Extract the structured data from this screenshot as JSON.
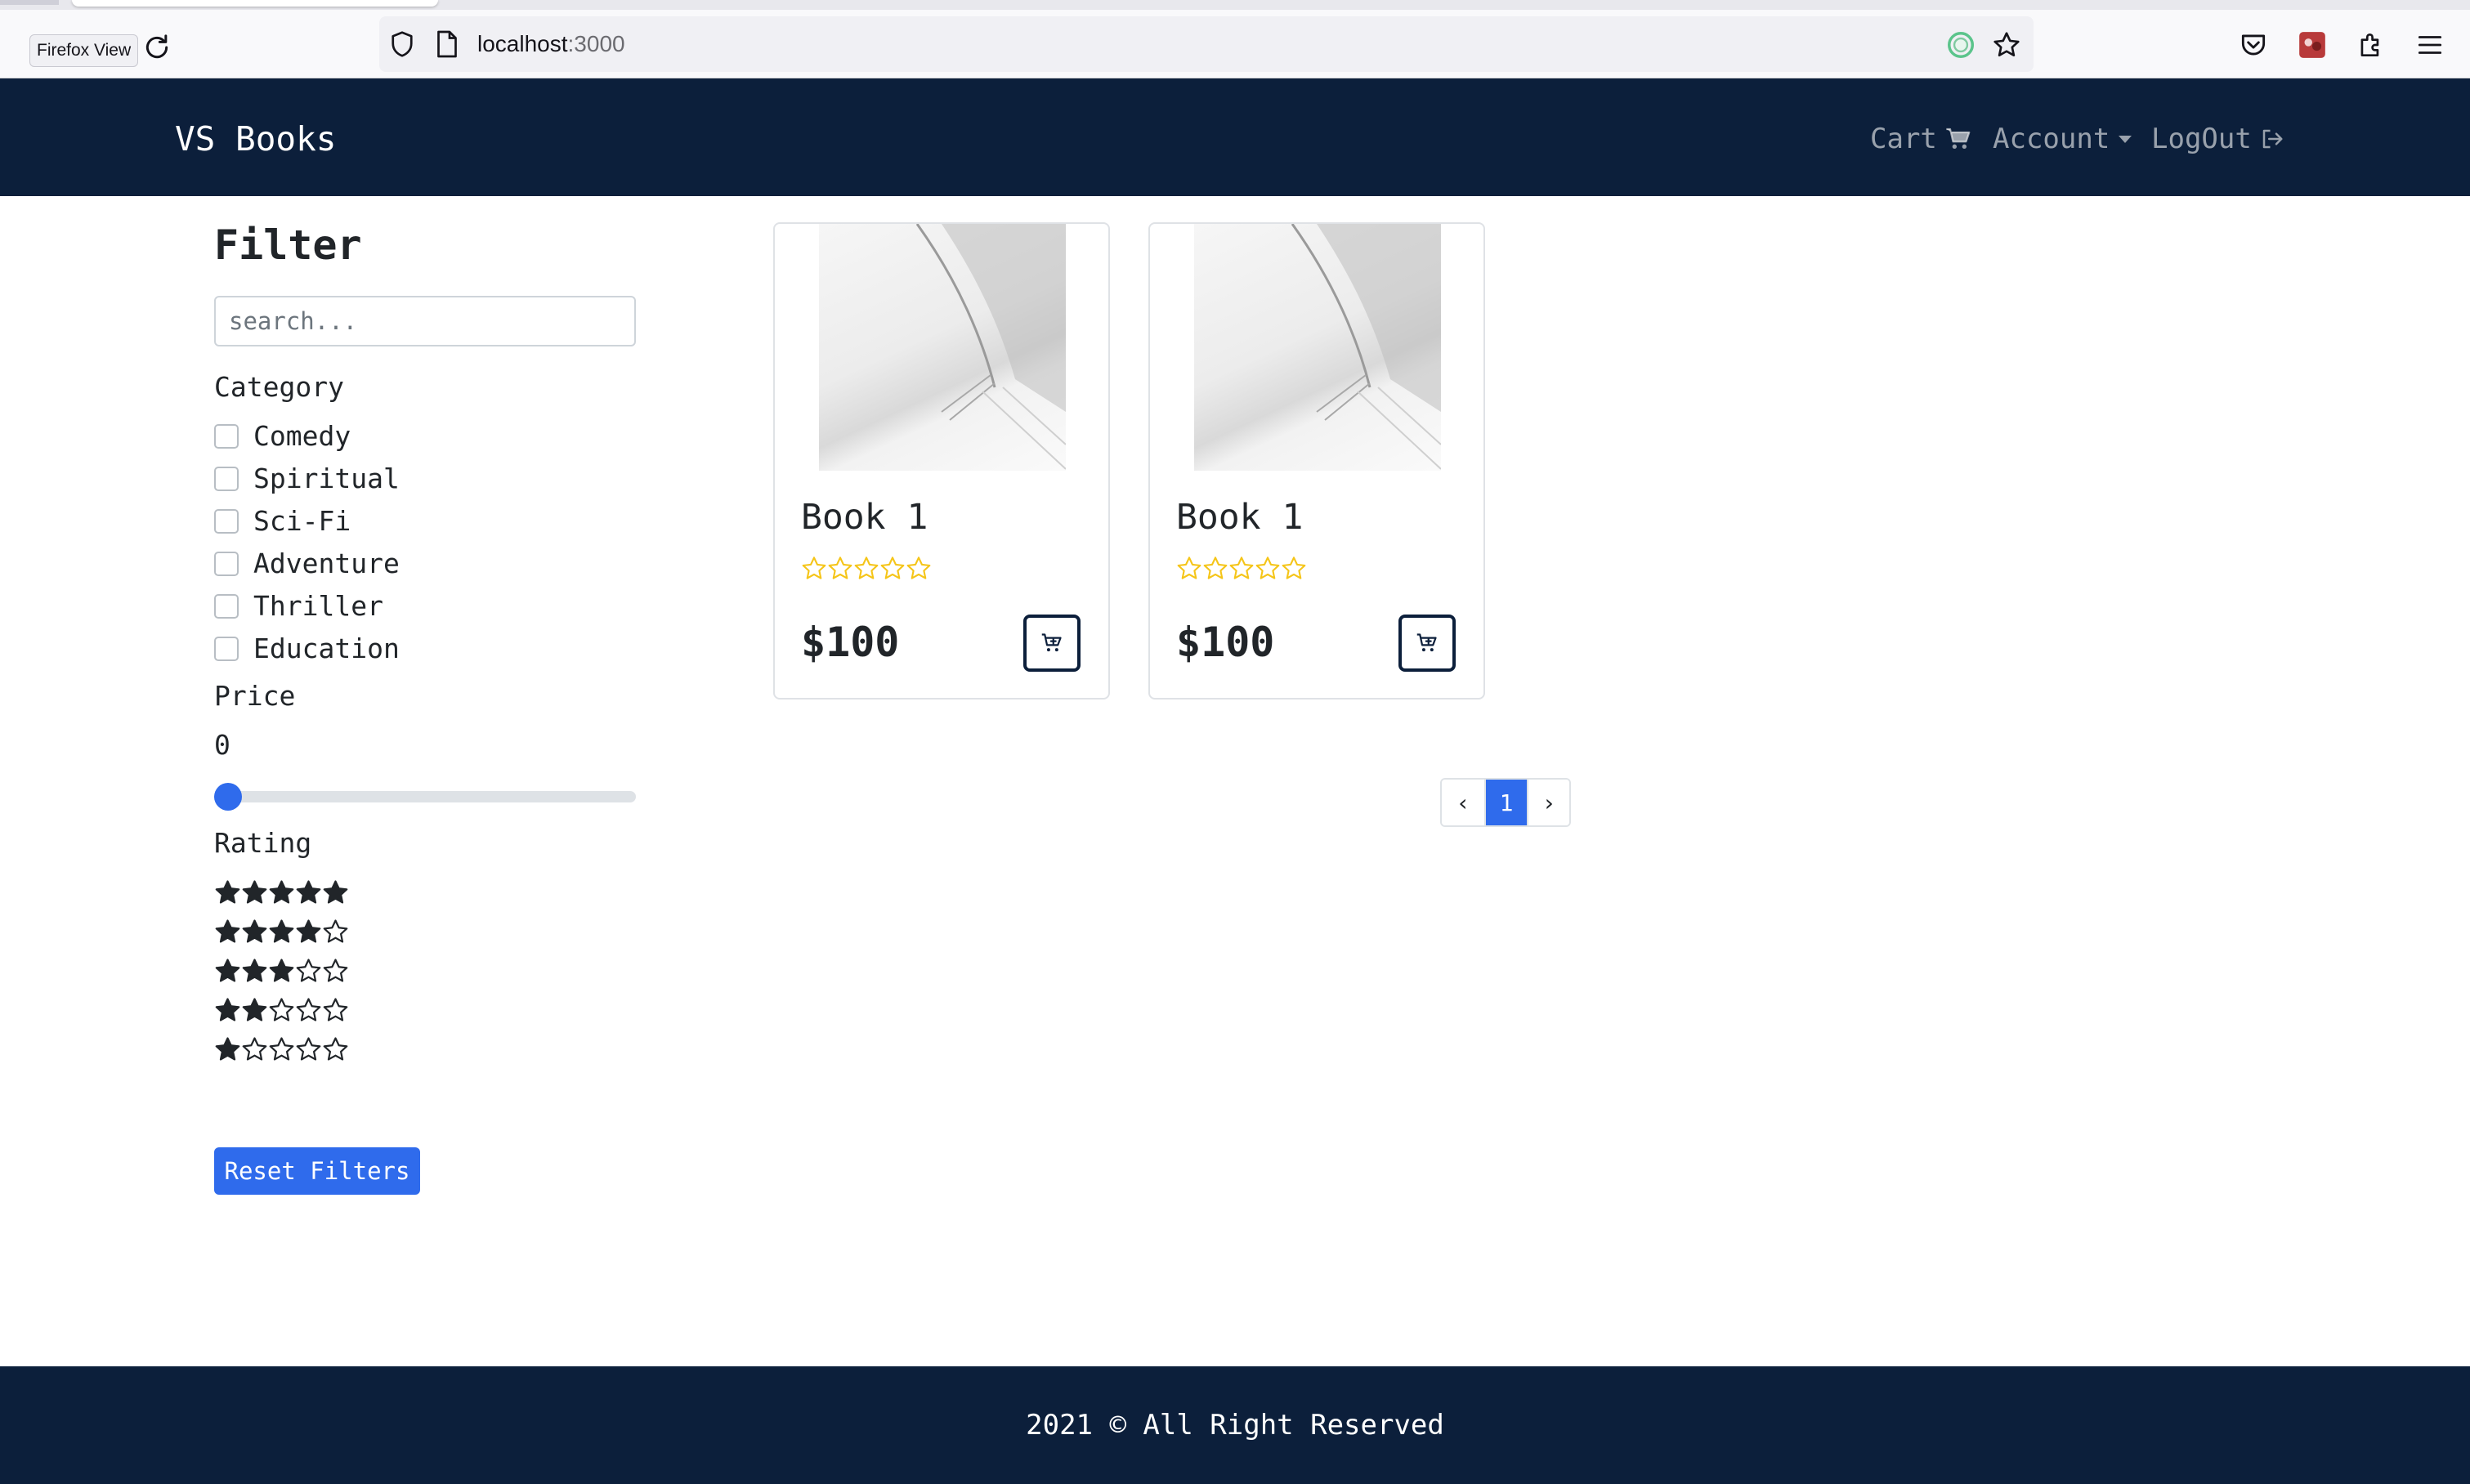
{
  "browser": {
    "tooltip": "Firefox View",
    "url_host": "localhost",
    "url_port": ":3000"
  },
  "navbar": {
    "brand": "VS Books",
    "cart_label": "Cart",
    "account_label": "Account",
    "logout_label": "LogOut"
  },
  "sidebar": {
    "title": "Filter",
    "search_placeholder": "search...",
    "category_label": "Category",
    "categories": [
      {
        "label": "Comedy",
        "checked": false
      },
      {
        "label": "Spiritual",
        "checked": false
      },
      {
        "label": "Sci-Fi",
        "checked": false
      },
      {
        "label": "Adventure",
        "checked": false
      },
      {
        "label": "Thriller",
        "checked": false
      },
      {
        "label": "Education",
        "checked": false
      }
    ],
    "price_label": "Price",
    "price_value": "0",
    "rating_label": "Rating",
    "rating_options": [
      5,
      4,
      3,
      2,
      1
    ],
    "reset_label": "Reset Filters"
  },
  "products": [
    {
      "title": "Book 1",
      "price": "$100",
      "rating": 0
    },
    {
      "title": "Book 1",
      "price": "$100",
      "rating": 0
    }
  ],
  "pagination": {
    "prev": "‹",
    "current": "1",
    "next": "›"
  },
  "footer": {
    "text": "2021 © All Right Reserved"
  },
  "colors": {
    "navbar_bg": "#0c1f3b",
    "primary": "#2f6bec",
    "star_outline": "#f5c518",
    "rating_star": "#212529"
  },
  "icons": {
    "cart": "shopping-cart-icon",
    "account_caret": "caret-down-icon",
    "logout": "logout-icon",
    "card_cart": "cart-plus-icon"
  }
}
